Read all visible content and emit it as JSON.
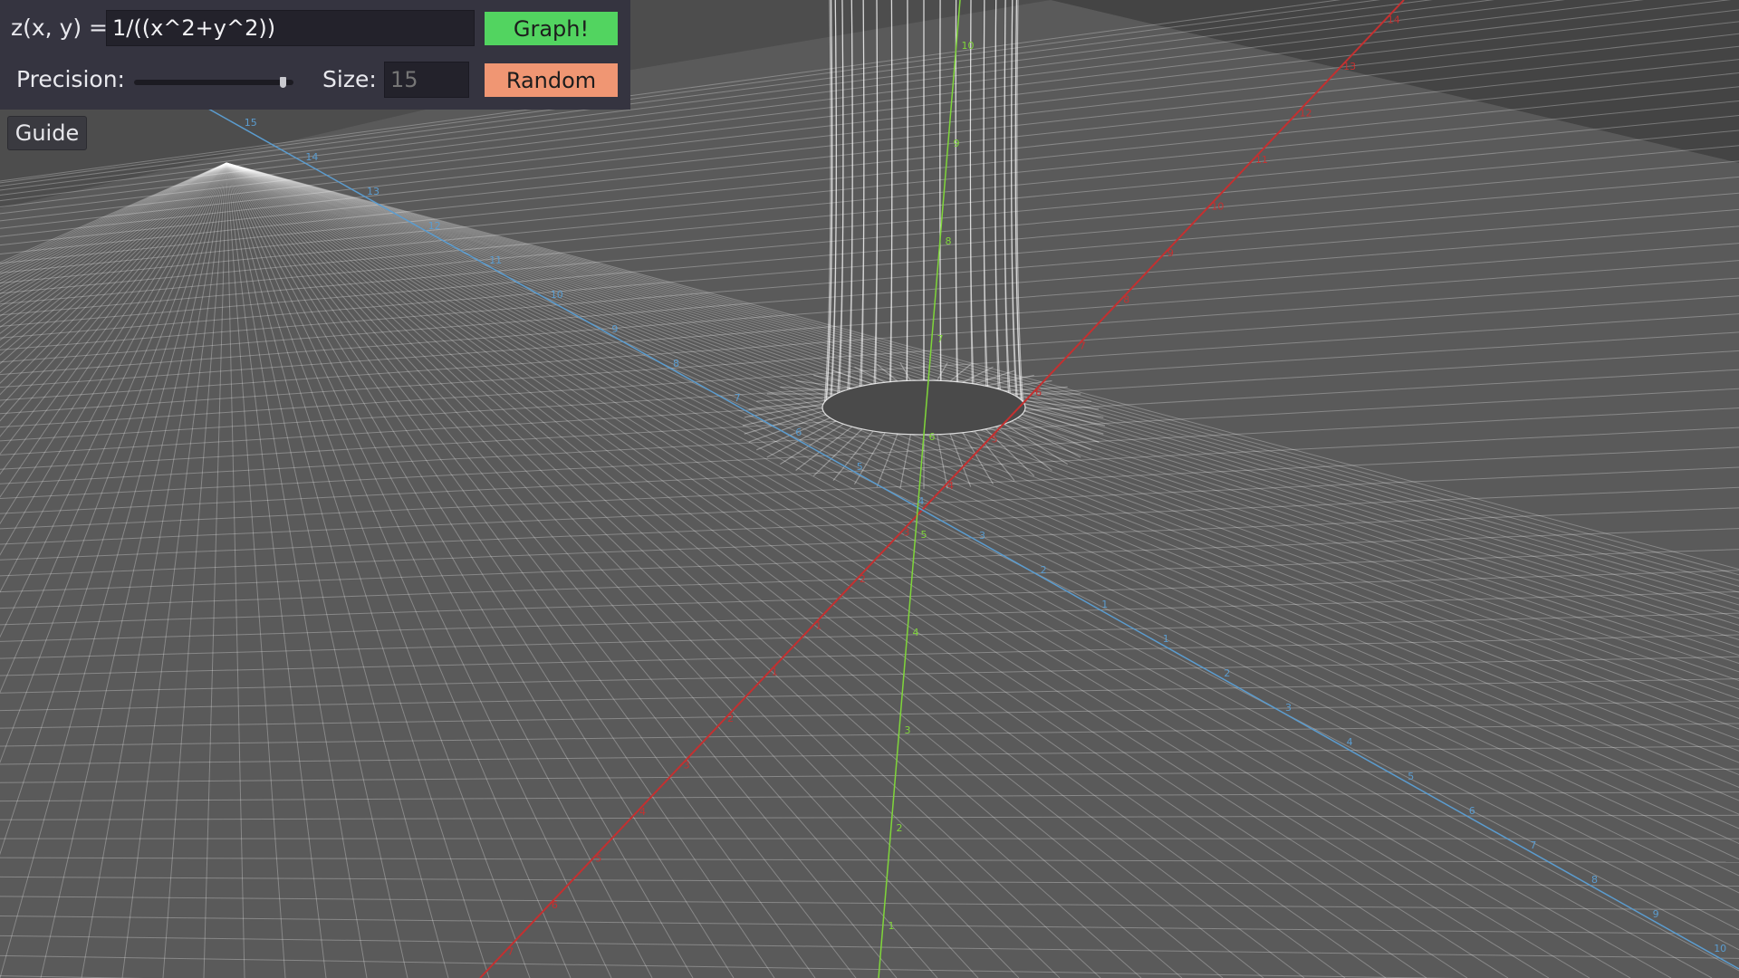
{
  "panel": {
    "equation_label": "z(x, y) =",
    "equation_value": "1/((x^2+y^2))",
    "graph_button": "Graph!",
    "precision_label": "Precision:",
    "precision_value": 0.95,
    "size_label": "Size:",
    "size_placeholder": "15",
    "random_button": "Random"
  },
  "guide_button": "Guide",
  "viewport": {
    "background_color": "#4d4d4d",
    "surface_color": "#ffffff",
    "x_axis_color": "#c43030",
    "y_axis_color": "#5b9ccf",
    "z_axis_color": "#7fd63a",
    "x_axis_ticks": [
      "14",
      "13",
      "12",
      "11",
      "10",
      "9",
      "8",
      "7",
      "6",
      "5",
      "4",
      "3",
      "2",
      "1",
      "1",
      "2",
      "3",
      "4",
      "5",
      "6",
      "7"
    ],
    "y_axis_ticks": [
      "15",
      "14",
      "13",
      "12",
      "11",
      "10",
      "9",
      "8",
      "7",
      "6",
      "5",
      "4",
      "3",
      "2",
      "1",
      "1",
      "2",
      "3",
      "4",
      "5",
      "6",
      "7",
      "8",
      "9",
      "10"
    ],
    "z_axis_ticks": [
      "1",
      "2",
      "3",
      "4",
      "5",
      "6",
      "7",
      "8",
      "9",
      "10"
    ]
  }
}
